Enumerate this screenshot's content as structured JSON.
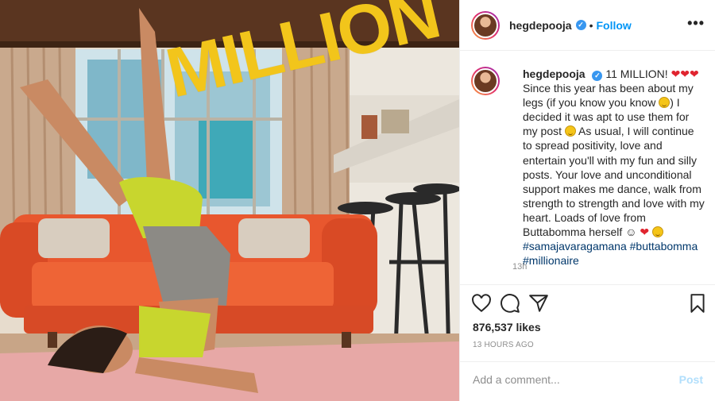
{
  "post": {
    "username": "hegdepooja",
    "verified_glyph": "✓",
    "follow_label": "Follow",
    "separator": "•",
    "more_label": "•••",
    "overlay_text": "MILLION"
  },
  "caption": {
    "username": "hegdepooja",
    "hearts": "❤❤❤",
    "text_1": "11 MILLION!",
    "text_2": "Since this year has been about my legs (if you know you know",
    "text_3": ") I decided it was apt to use them for my post",
    "text_4": "As usual, I will continue to spread positivity, love and entertain you'll with my fun and silly posts. Your love and unconditional support makes me dance, walk from strength to strength and love with my heart. Loads of love from Buttabomma herself",
    "text_5": "☺",
    "heart_single": "❤",
    "hashtags": [
      "#samajavaragamana",
      "#buttabomma",
      "#millionaire"
    ],
    "time": "13h"
  },
  "actions": {
    "icons": [
      "heart-icon",
      "comment-icon",
      "share-icon",
      "bookmark-icon"
    ],
    "likes": "876,537 likes",
    "posted_ago": "13 HOURS AGO"
  },
  "comment": {
    "placeholder": "Add a comment...",
    "post_label": "Post"
  },
  "colors": {
    "link_blue": "#0095f6",
    "hashtag": "#00376b",
    "muted": "#8e8e8e",
    "overlay_yellow": "#f2c51b",
    "sofa_orange": "#e8572e"
  }
}
